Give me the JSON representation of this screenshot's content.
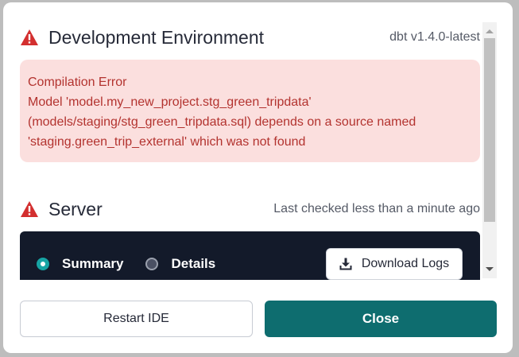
{
  "dev_env": {
    "title": "Development Environment",
    "version": "dbt v1.4.0-latest",
    "error": {
      "heading": "Compilation Error",
      "lines": [
        "Model 'model.my_new_project.stg_green_tripdata'",
        "(models/staging/stg_green_tripdata.sql) depends on a source named",
        "'staging.green_trip_external' which was not found"
      ]
    }
  },
  "server": {
    "title": "Server",
    "last_checked": "Last checked less than a minute ago",
    "options": [
      {
        "label": "Summary",
        "selected": true
      },
      {
        "label": "Details",
        "selected": false
      }
    ],
    "download_logs_label": "Download Logs"
  },
  "footer": {
    "restart_label": "Restart IDE",
    "close_label": "Close"
  },
  "icons": {
    "warning": "warning-triangle-icon",
    "download": "download-icon"
  },
  "colors": {
    "warning_red": "#d32f2f",
    "error_bg": "#fbdfde",
    "error_text": "#b3332f",
    "accent_teal": "#0e6d6f",
    "radio_teal": "#17a4a4",
    "panel_dark": "#131a2a"
  }
}
